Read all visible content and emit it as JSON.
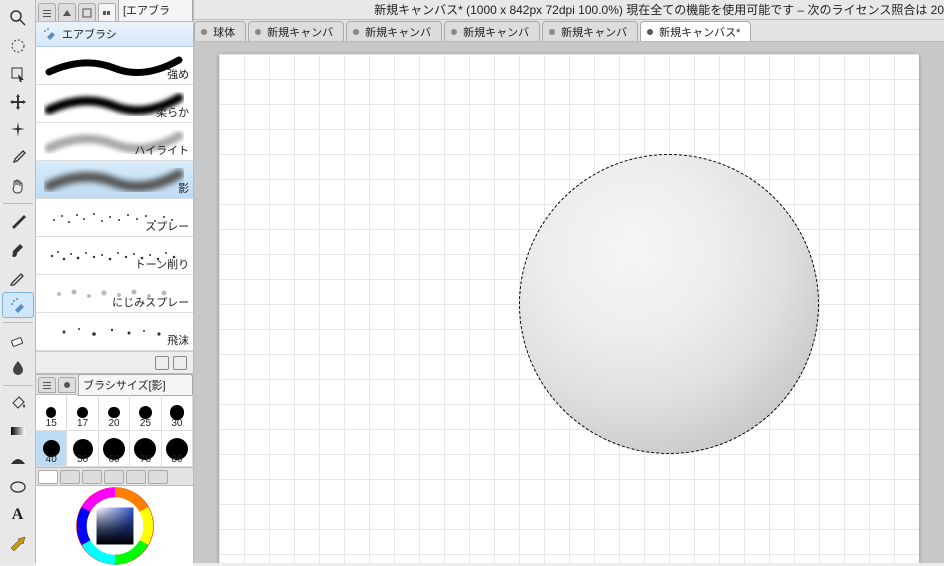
{
  "title_bar": "新規キャンバス* (1000 x 842px 72dpi 100.0%)  現在全ての機能を使用可能です – 次のライセンス照合は 20",
  "doc_tabs": [
    {
      "label": "球体"
    },
    {
      "label": "新規キャンバ"
    },
    {
      "label": "新規キャンバ"
    },
    {
      "label": "新規キャンバ"
    },
    {
      "label": "新規キャンバ"
    },
    {
      "label": "新規キャンバス*",
      "active": true
    }
  ],
  "subtool_panel": {
    "tab_label": "サブツール[エアブラ",
    "group": "エアブラシ",
    "brushes": [
      {
        "label": "強め"
      },
      {
        "label": "柔らか"
      },
      {
        "label": "ハイライト"
      },
      {
        "label": "影",
        "selected": true
      },
      {
        "label": "スプレー"
      },
      {
        "label": "トーン削り"
      },
      {
        "label": "にじみスプレー"
      },
      {
        "label": "飛沫"
      }
    ]
  },
  "brush_size_panel": {
    "label": "ブラシサイズ[影]",
    "sizes": [
      15,
      17,
      20,
      25,
      30,
      40,
      50,
      60,
      70,
      80
    ],
    "selected": 40
  },
  "tools": [
    "magnify",
    "lasso",
    "cursor",
    "move",
    "sparkle",
    "eyedropper",
    "hand",
    "sep",
    "pen",
    "brush",
    "pencil",
    "airbrush",
    "sep",
    "eraser",
    "blend",
    "sep",
    "fill-tool",
    "gradient",
    "shading",
    "ellipse",
    "text",
    "line"
  ]
}
